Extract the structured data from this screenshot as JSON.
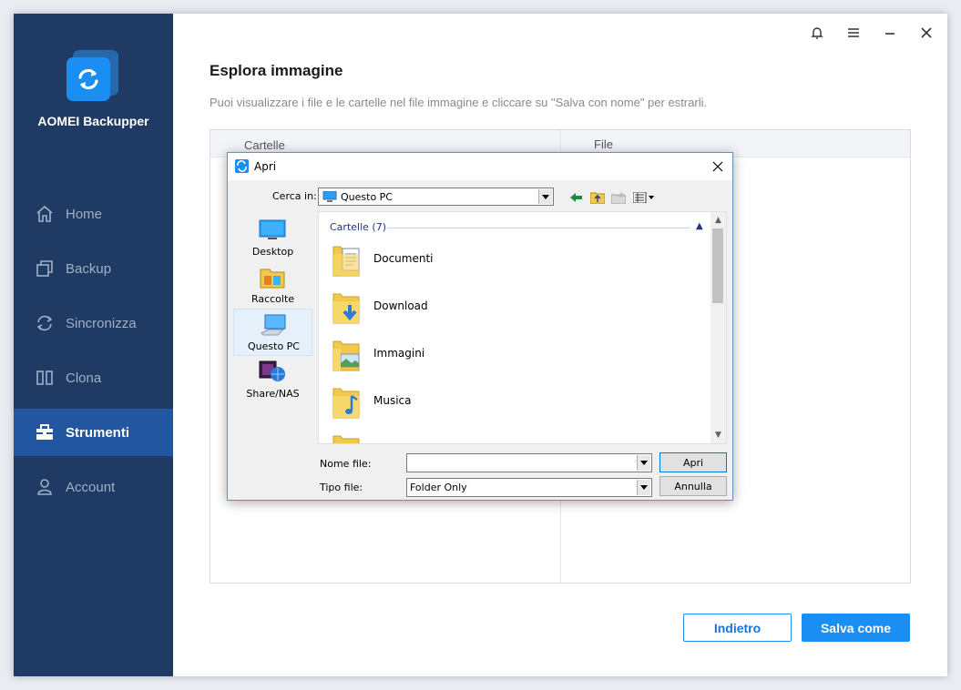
{
  "app": {
    "name": "AOMEI Backupper"
  },
  "sidebar": {
    "items": [
      {
        "label": "Home",
        "icon": "home-icon",
        "active": false
      },
      {
        "label": "Backup",
        "icon": "backup-icon",
        "active": false
      },
      {
        "label": "Sincronizza",
        "icon": "sync-icon",
        "active": false
      },
      {
        "label": "Clona",
        "icon": "clone-icon",
        "active": false
      },
      {
        "label": "Strumenti",
        "icon": "tools-icon",
        "active": true
      },
      {
        "label": "Account",
        "icon": "account-icon",
        "active": false
      }
    ]
  },
  "header": {
    "icons": [
      "bell-icon",
      "menu-icon",
      "minimize-icon",
      "close-icon"
    ]
  },
  "main": {
    "title": "Esplora immagine",
    "description": "Puoi visualizzare i file e le cartelle nel file immagine e cliccare su \"Salva con nome\" per estrarli.",
    "columns": {
      "folders": "Cartelle",
      "files": "File"
    },
    "buttons": {
      "back": "Indietro",
      "save_as": "Salva come"
    }
  },
  "dialog": {
    "title": "Apri",
    "look_in_label": "Cerca in:",
    "look_in_value": "Questo PC",
    "places": [
      {
        "label": "Desktop",
        "icon": "desktop-icon",
        "selected": false
      },
      {
        "label": "Raccolte",
        "icon": "libraries-icon",
        "selected": false
      },
      {
        "label": "Questo PC",
        "icon": "computer-icon",
        "selected": true
      },
      {
        "label": "Share/NAS",
        "icon": "network-share-icon",
        "selected": false
      }
    ],
    "group_header": "Cartelle (7)",
    "folders": [
      {
        "label": "Documenti",
        "icon": "documents-folder-icon"
      },
      {
        "label": "Download",
        "icon": "downloads-folder-icon"
      },
      {
        "label": "Immagini",
        "icon": "pictures-folder-icon"
      },
      {
        "label": "Musica",
        "icon": "music-folder-icon"
      }
    ],
    "file_name_label": "Nome file:",
    "file_name_value": "",
    "file_type_label": "Tipo file:",
    "file_type_value": "Folder Only",
    "open_button": "Apri",
    "cancel_button": "Annulla"
  },
  "colors": {
    "sidebar_bg": "#1f3a63",
    "sidebar_active": "#2356a0",
    "accent": "#1a8ef2"
  }
}
